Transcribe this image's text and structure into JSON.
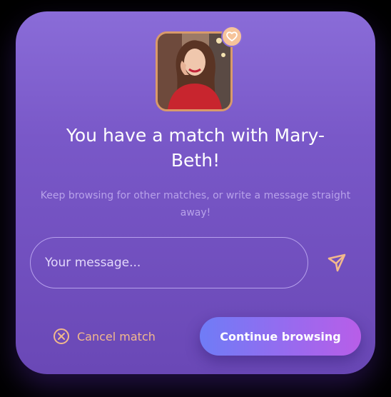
{
  "dialog": {
    "title": "You have a match with Mary-Beth!",
    "subtitle": "Keep browsing for other matches, or write a message straight away!",
    "message_placeholder": "Your message...",
    "message_value": "",
    "cancel_label": "Cancel match",
    "continue_label": "Continue browsing"
  },
  "icons": {
    "badge": "hearts-icon",
    "send": "send-icon",
    "cancel": "close-circle-icon"
  },
  "colors": {
    "accent_orange": "#f2b98c",
    "button_gradient_start": "#6f7cf6",
    "button_gradient_end": "#b85ee8",
    "card_top": "#8a6cd8",
    "card_bottom": "#6a48b6"
  }
}
